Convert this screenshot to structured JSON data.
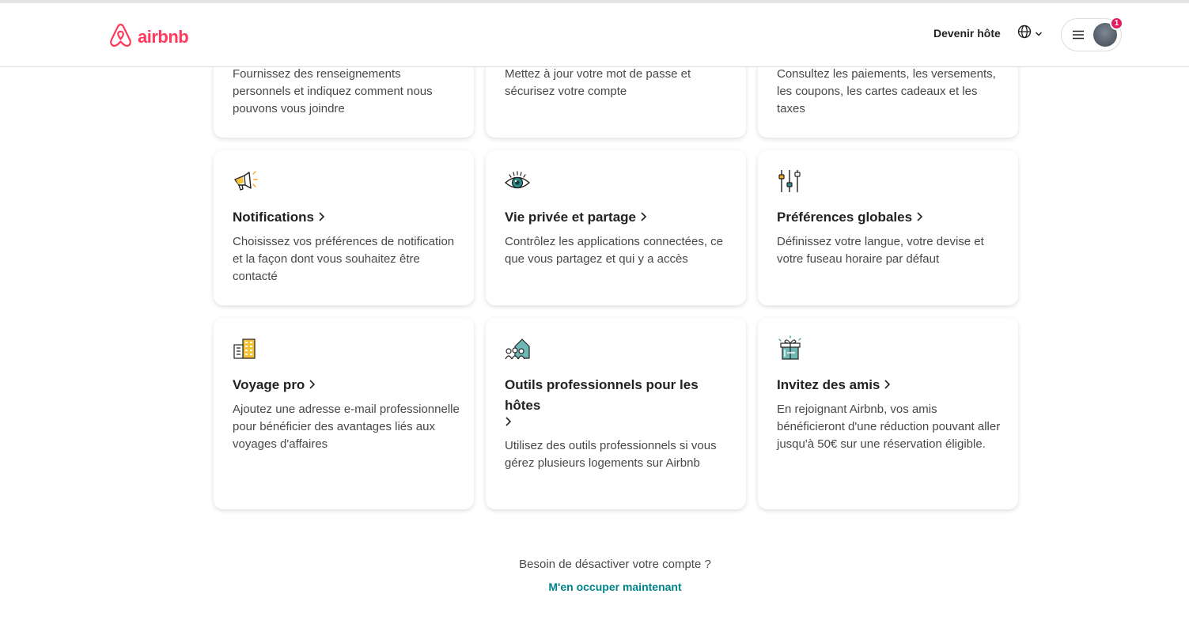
{
  "header": {
    "brand": "airbnb",
    "host_link": "Devenir hôte",
    "notification_count": "1",
    "brand_color": "#FF385C"
  },
  "cards": [
    {
      "icon": "",
      "title": "",
      "desc": "Fournissez des renseignements personnels et indiquez comment nous pouvons vous joindre"
    },
    {
      "icon": "",
      "title": "",
      "desc": "Mettez à jour votre mot de passe et sécurisez votre compte"
    },
    {
      "icon": "",
      "title": "",
      "desc": "Consultez les paiements, les versements, les coupons, les cartes cadeaux et les taxes"
    },
    {
      "icon": "megaphone-icon",
      "title": "Notifications",
      "desc": "Choisissez vos préférences de notification et la façon dont vous souhaitez être contacté"
    },
    {
      "icon": "eye-icon",
      "title": "Vie privée et partage",
      "desc": "Contrôlez les applications connectées, ce que vous partagez et qui y a accès"
    },
    {
      "icon": "sliders-icon",
      "title": "Préférences globales",
      "desc": "Définissez votre langue, votre devise et votre fuseau horaire par défaut"
    },
    {
      "icon": "building-icon",
      "title": "Voyage pro",
      "desc": "Ajoutez une adresse e-mail professionnelle pour bénéficier des avantages liés aux voyages d'affaires"
    },
    {
      "icon": "houses-icon",
      "title": "Outils professionnels pour les hôtes",
      "desc": "Utilisez des outils professionnels si vous gérez plusieurs logements sur Airbnb"
    },
    {
      "icon": "gift-icon",
      "title": "Invitez des amis",
      "desc": "En rejoignant Airbnb, vos amis bénéficieront d'une réduction pouvant aller jusqu'à 50€ sur une réservation éligible."
    }
  ],
  "footer": {
    "question": "Besoin de désactiver votre compte ?",
    "link": "M'en occuper maintenant",
    "link_color": "#008489"
  }
}
